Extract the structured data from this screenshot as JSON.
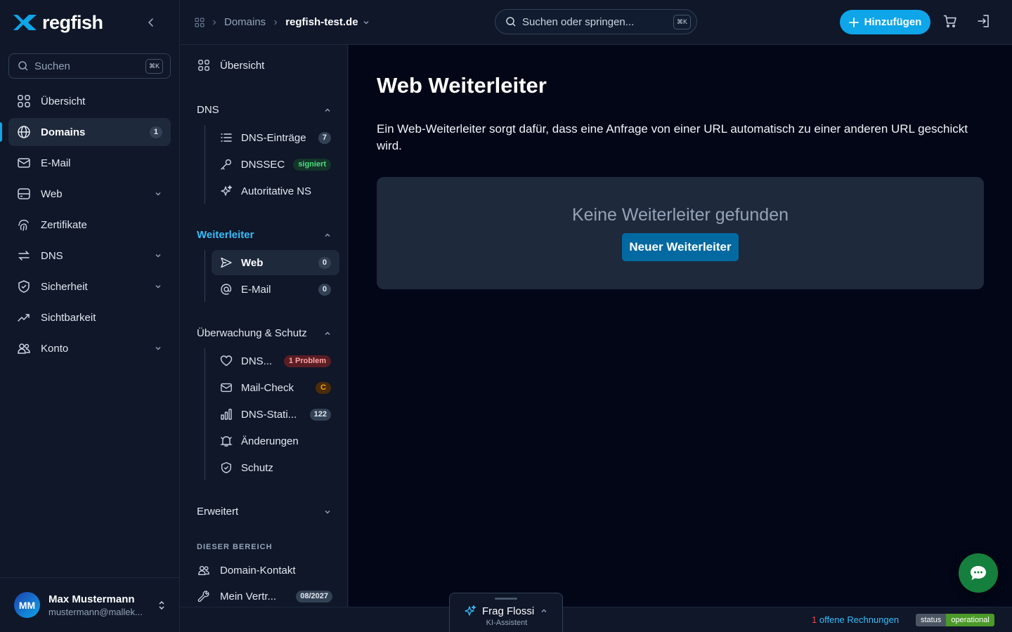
{
  "app": {
    "logo_text": "regfish"
  },
  "sidebar": {
    "search_label": "Suchen",
    "search_kbd": "⌘K",
    "items": [
      {
        "label": "Übersicht",
        "icon": "grid-icon"
      },
      {
        "label": "Domains",
        "icon": "globe-icon",
        "count": "1",
        "active": true
      },
      {
        "label": "E-Mail",
        "icon": "mail-icon"
      },
      {
        "label": "Web",
        "icon": "server-icon",
        "expandable": true
      },
      {
        "label": "Zertifikate",
        "icon": "fingerprint-icon"
      },
      {
        "label": "DNS",
        "icon": "arrows-icon",
        "expandable": true
      },
      {
        "label": "Sicherheit",
        "icon": "shield-icon",
        "expandable": true
      },
      {
        "label": "Sichtbarkeit",
        "icon": "trend-icon"
      },
      {
        "label": "Konto",
        "icon": "users-icon",
        "expandable": true
      }
    ],
    "user": {
      "initials": "MM",
      "name": "Max Mustermann",
      "email": "mustermann@mallek..."
    }
  },
  "topbar": {
    "breadcrumb": {
      "section": "Domains",
      "current": "regfish-test.de"
    },
    "search_placeholder": "Suchen oder springen...",
    "search_kbd": "⌘K",
    "add_label": "Hinzufügen"
  },
  "subnav": {
    "overview": "Übersicht",
    "dns": {
      "title": "DNS",
      "items": [
        {
          "label": "DNS-Einträge",
          "badge": "7"
        },
        {
          "label": "DNSSEC",
          "badge": "signiert"
        },
        {
          "label": "Autoritative NS"
        }
      ]
    },
    "forwarders": {
      "title": "Weiterleiter",
      "items": [
        {
          "label": "Web",
          "badge": "0",
          "active": true
        },
        {
          "label": "E-Mail",
          "badge": "0"
        }
      ]
    },
    "monitoring": {
      "title": "Überwachung & Schutz",
      "items": [
        {
          "label": "DNS...",
          "badge": "1 Problem"
        },
        {
          "label": "Mail-Check",
          "badge": "C"
        },
        {
          "label": "DNS-Stati...",
          "badge": "122"
        },
        {
          "label": "Änderungen"
        },
        {
          "label": "Schutz"
        }
      ]
    },
    "advanced": {
      "title": "Erweitert"
    },
    "this_area": {
      "caption": "DIESER BEREICH",
      "items": [
        {
          "label": "Domain-Kontakt"
        },
        {
          "label": "Mein Vertr...",
          "badge": "08/2027"
        }
      ]
    }
  },
  "main": {
    "title": "Web Weiterleiter",
    "description": "Ein Web-Weiterleiter sorgt dafür, dass eine Anfrage von einer URL automatisch zu einer anderen URL geschickt wird.",
    "empty_title": "Keine Weiterleiter gefunden",
    "empty_button": "Neuer Weiterleiter"
  },
  "bottombar": {
    "invoices_count": "1",
    "invoices_label": "offene Rechnungen",
    "status_key": "status",
    "status_value": "operational",
    "assistant_title": "Frag Flossi",
    "assistant_sub": "KI-Assistent"
  },
  "colors": {
    "accent": "#0ea5e9",
    "background": "#0f1729",
    "main_bg": "#020617",
    "success": "#15803d"
  }
}
